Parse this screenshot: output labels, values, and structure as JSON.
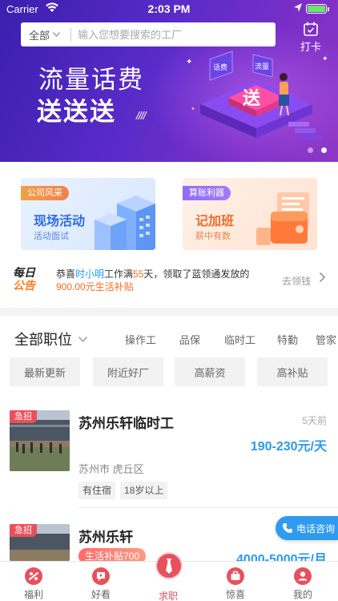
{
  "status_bar": {
    "carrier": "Carrier",
    "time": "2:03 PM"
  },
  "header": {
    "search_scope": "全部",
    "search_placeholder": "输入您想要搜索的工厂",
    "checkin_label": "打卡"
  },
  "banner": {
    "title_line1": "流量话费",
    "title_line2": "送送送",
    "slashes": "////",
    "sign_left": "话费",
    "sign_right": "流量",
    "total_slides": 2,
    "active_slide": 2
  },
  "promo_cards": [
    {
      "tag": "公司风采",
      "title": "现场活动",
      "subtitle": "活动面试"
    },
    {
      "tag": "算账利器",
      "title": "记加班",
      "subtitle": "薪中有数"
    }
  ],
  "daily_notice": {
    "logo_line1": "每日",
    "logo_line2": "公告",
    "text_prefix": "恭喜",
    "name": "时小明",
    "text_mid": "工作满",
    "days": "55",
    "text_suffix": "天，领取了蓝领通发放的",
    "amount": "900.00元生活补贴",
    "action": "去领钱"
  },
  "filters": {
    "all_positions": "全部职位",
    "categories": [
      "操作工",
      "品保",
      "临时工",
      "特勤",
      "管家"
    ],
    "chips": [
      "最新更新",
      "附近好厂",
      "高薪资",
      "高补贴"
    ]
  },
  "jobs": [
    {
      "urgent": "急招",
      "title": "苏州乐轩临时工",
      "ago": "5天前",
      "pay": "190-230元/天",
      "location": "苏州市 虎丘区",
      "tags": [
        "有住宿",
        "18岁以上"
      ]
    },
    {
      "urgent": "急招",
      "title": "苏州乐轩",
      "bonus": "生活补贴700",
      "pay": "4000-5000元/月"
    }
  ],
  "phone_consult": "电话咨询",
  "tabbar": {
    "items": [
      {
        "label": "福利",
        "icon": "welfare-icon"
      },
      {
        "label": "好看",
        "icon": "video-icon"
      },
      {
        "label": "求职",
        "icon": "tie-icon"
      },
      {
        "label": "惊喜",
        "icon": "gift-bag-icon"
      },
      {
        "label": "我的",
        "icon": "profile-icon"
      }
    ],
    "active": "求职"
  },
  "colors": {
    "banner_start": "#3b1fae",
    "banner_end": "#8e36c6",
    "accent_red": "#e8505b",
    "accent_blue": "#2a9af0",
    "accent_orange": "#ff6a1c"
  }
}
